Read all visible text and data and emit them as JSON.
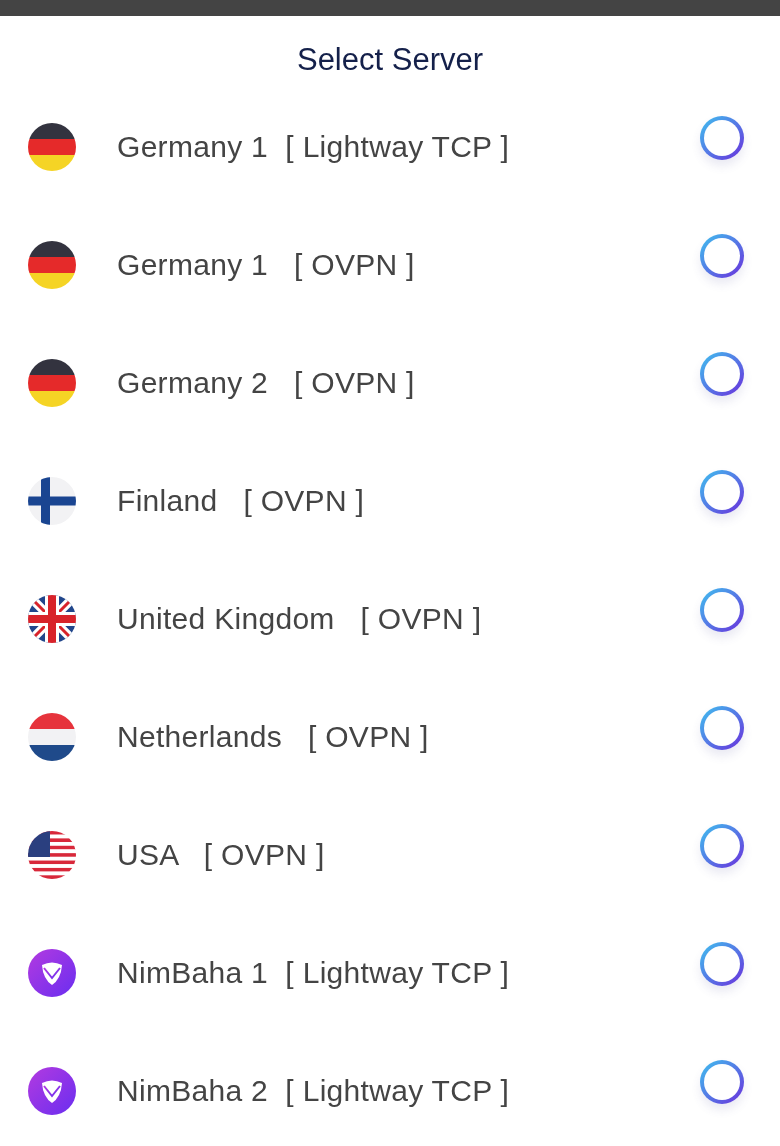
{
  "title": "Select Server",
  "servers": [
    {
      "kind": "germany",
      "label": "Germany 1  [ Lightway TCP ]",
      "selected": false
    },
    {
      "kind": "germany",
      "label": "Germany 1   [ OVPN ]",
      "selected": false
    },
    {
      "kind": "germany",
      "label": "Germany 2   [ OVPN ]",
      "selected": false
    },
    {
      "kind": "finland",
      "label": "Finland   [ OVPN ]",
      "selected": false
    },
    {
      "kind": "uk",
      "label": "United Kingdom   [ OVPN ]",
      "selected": false
    },
    {
      "kind": "netherlands",
      "label": "Netherlands   [ OVPN ]",
      "selected": false
    },
    {
      "kind": "usa",
      "label": "USA   [ OVPN ]",
      "selected": false
    },
    {
      "kind": "brand",
      "label": "NimBaha 1  [ Lightway TCP ]",
      "selected": false
    },
    {
      "kind": "brand",
      "label": "NimBaha 2  [ Lightway TCP ]",
      "selected": false
    }
  ]
}
